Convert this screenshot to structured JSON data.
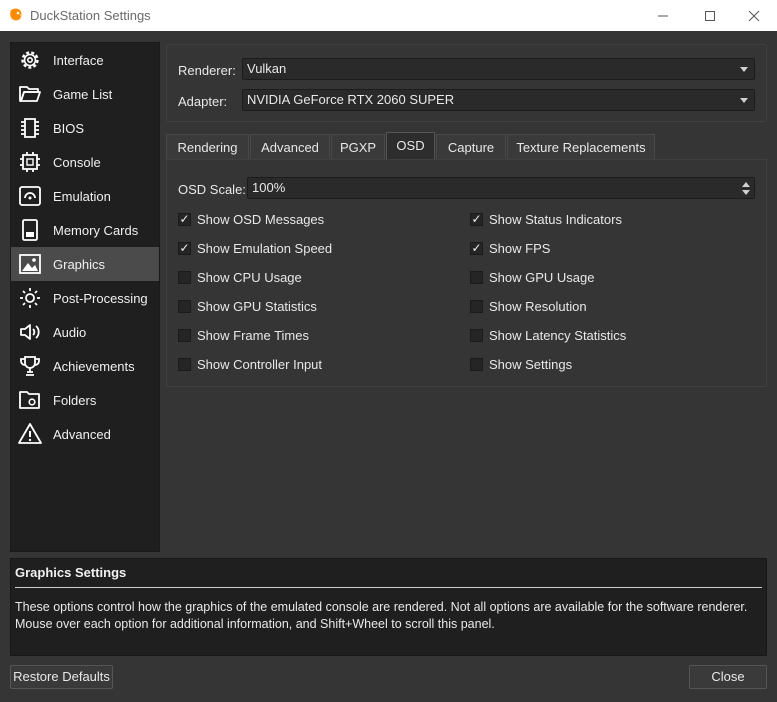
{
  "window": {
    "title": "DuckStation Settings"
  },
  "sidebar": {
    "items": [
      {
        "label": "Interface",
        "icon": "settings-icon"
      },
      {
        "label": "Game List",
        "icon": "folder-open-icon"
      },
      {
        "label": "BIOS",
        "icon": "chip-icon"
      },
      {
        "label": "Console",
        "icon": "cpu-icon"
      },
      {
        "label": "Emulation",
        "icon": "emulation-icon"
      },
      {
        "label": "Memory Cards",
        "icon": "memory-card-icon"
      },
      {
        "label": "Graphics",
        "icon": "image-icon"
      },
      {
        "label": "Post-Processing",
        "icon": "brightness-icon"
      },
      {
        "label": "Audio",
        "icon": "speaker-icon"
      },
      {
        "label": "Achievements",
        "icon": "trophy-icon"
      },
      {
        "label": "Folders",
        "icon": "folder-settings-icon"
      },
      {
        "label": "Advanced",
        "icon": "warning-icon"
      }
    ],
    "active": "Graphics"
  },
  "renderer": {
    "label": "Renderer:",
    "value": "Vulkan"
  },
  "adapter": {
    "label": "Adapter:",
    "value": "NVIDIA GeForce RTX 2060 SUPER"
  },
  "tabs": [
    {
      "label": "Rendering"
    },
    {
      "label": "Advanced"
    },
    {
      "label": "PGXP"
    },
    {
      "label": "OSD"
    },
    {
      "label": "Capture"
    },
    {
      "label": "Texture Replacements"
    }
  ],
  "active_tab": "OSD",
  "osd": {
    "scale_label": "OSD Scale:",
    "scale_value": "100%",
    "options": [
      {
        "label": "Show OSD Messages",
        "checked": true
      },
      {
        "label": "Show Status Indicators",
        "checked": true
      },
      {
        "label": "Show Emulation Speed",
        "checked": true
      },
      {
        "label": "Show FPS",
        "checked": true
      },
      {
        "label": "Show CPU Usage",
        "checked": false
      },
      {
        "label": "Show GPU Usage",
        "checked": false
      },
      {
        "label": "Show GPU Statistics",
        "checked": false
      },
      {
        "label": "Show Resolution",
        "checked": false
      },
      {
        "label": "Show Frame Times",
        "checked": false
      },
      {
        "label": "Show Latency Statistics",
        "checked": false
      },
      {
        "label": "Show Controller Input",
        "checked": false
      },
      {
        "label": "Show Settings",
        "checked": false
      }
    ]
  },
  "description": {
    "title": "Graphics Settings",
    "text": "These options control how the graphics of the emulated console are rendered. Not all options are available for the software renderer. Mouse over each option for additional information, and Shift+Wheel to scroll this panel."
  },
  "buttons": {
    "restore": "Restore Defaults",
    "close": "Close"
  },
  "glyphs": {
    "check": "✓"
  },
  "colors": {
    "accent": "#ff8c00",
    "background": "#353535",
    "sidebar": "#1f1f1f"
  }
}
